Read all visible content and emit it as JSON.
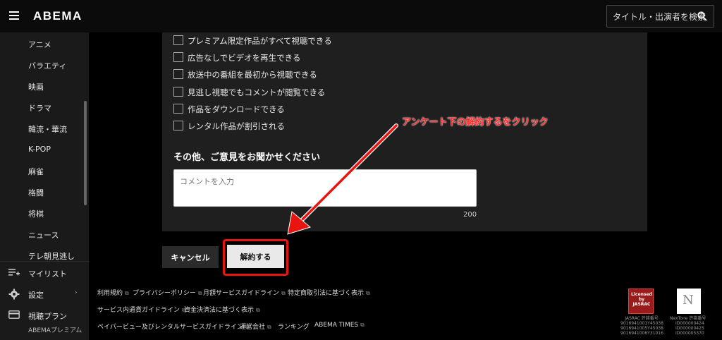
{
  "header": {
    "logo": "ABEMA",
    "search_placeholder": "タイトル・出演者を検索"
  },
  "sidebar": {
    "categories": [
      "アニメ",
      "バラエティ",
      "映画",
      "ドラマ",
      "韓流・華流",
      "K-POP",
      "麻雀",
      "格闘",
      "将棋",
      "ニュース",
      "テレ朝見逃し"
    ],
    "mylist": "マイリスト",
    "settings": "設定",
    "plan": "視聴プラン",
    "plan_sub": "ABEMAプレミアム"
  },
  "survey": {
    "options": [
      "プレミアム限定作品がすべて視聴できる",
      "広告なしでビデオを再生できる",
      "放送中の番組を最初から視聴できる",
      "見逃し視聴でもコメントが閲覧できる",
      "作品をダウンロードできる",
      "レンタル作品が割引される"
    ],
    "other_title": "その他、ご意見をお聞かせください",
    "comment_placeholder": "コメントを入力",
    "char_limit": "200"
  },
  "buttons": {
    "cancel": "キャンセル",
    "unsubscribe": "解約する"
  },
  "annotation": {
    "text": "アンケート下の解約するをクリック",
    "color": "#e8150f"
  },
  "footer": {
    "links_row1": [
      "利用規約",
      "プライバシーポリシー",
      "月額サービスガイドライン",
      "特定商取引法に基づく表示"
    ],
    "links_row2": [
      "サービス内通貨ガイドライン",
      "資金決済法に基づく表示"
    ],
    "links_row3": [
      "ペイパービュー及びレンタルサービスガイドライン",
      "運営会社",
      "ランキング",
      "ABEMA TIMES"
    ],
    "jasrac_badge": "Licensed by JASRAC",
    "jasrac_label": "JASRAC 許諾番号",
    "jasrac_numbers": [
      "9016941001Y45038",
      "9016941005Y45038",
      "9016941006Y31016"
    ],
    "nextone_label": "NexTone 許諾番号",
    "nextone_numbers": [
      "ID000000424",
      "ID000000425",
      "ID000005370"
    ]
  }
}
